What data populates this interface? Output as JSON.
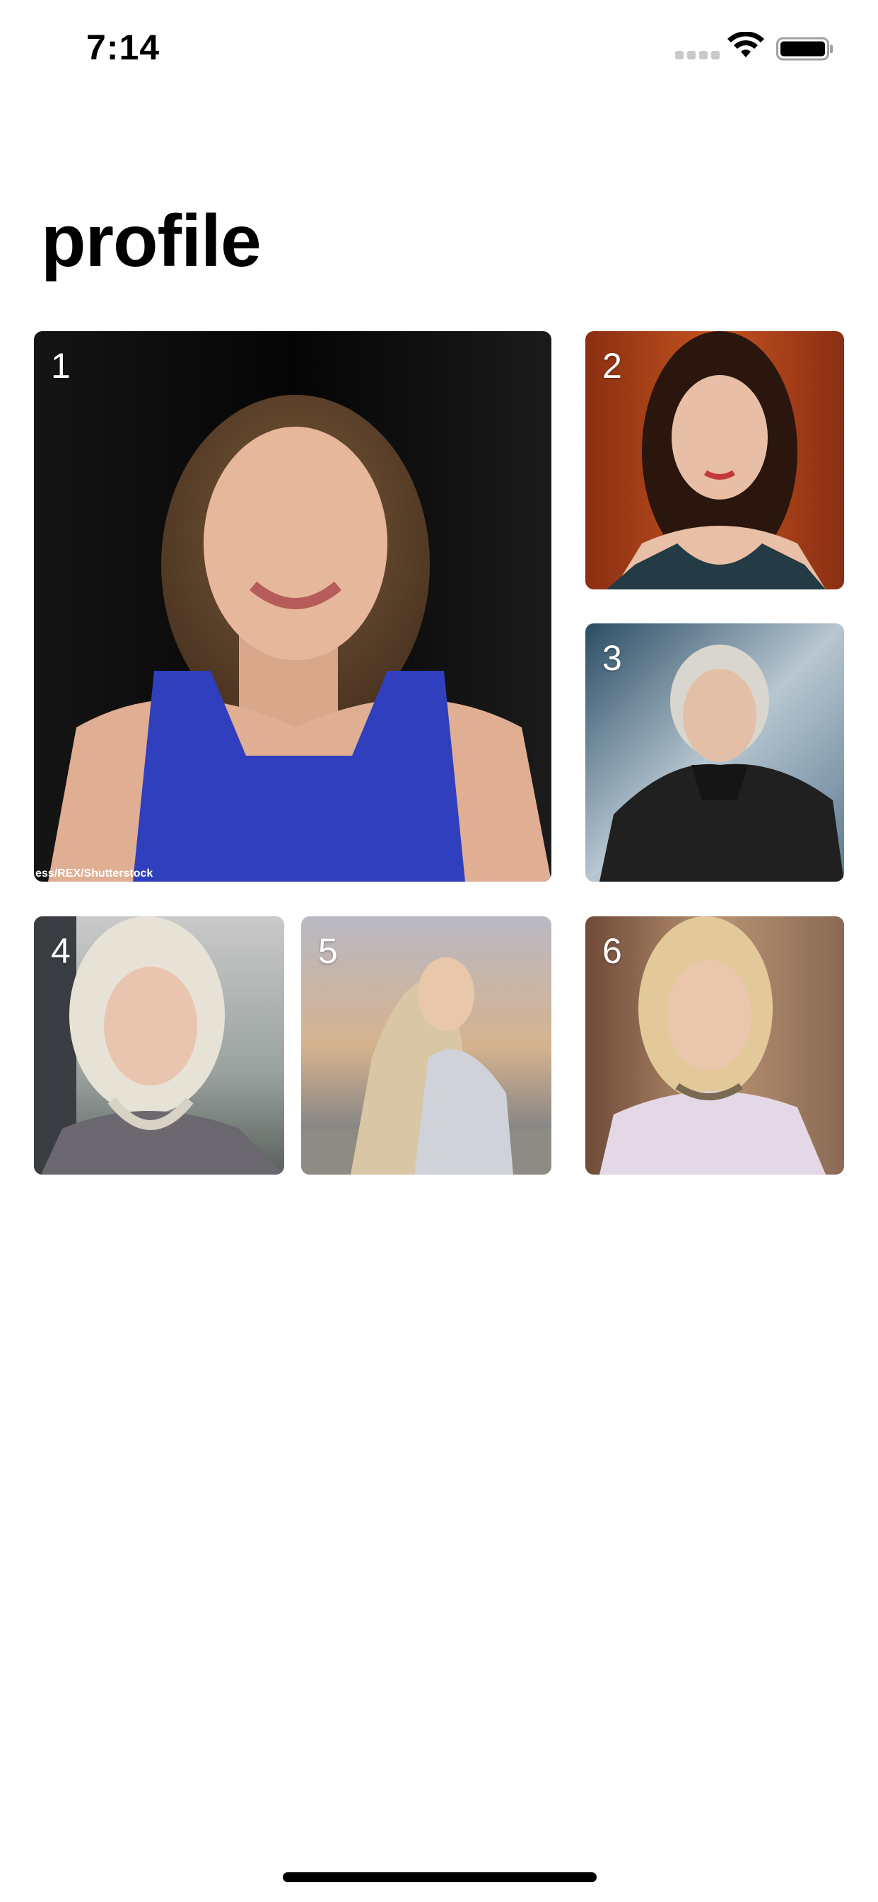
{
  "status_bar": {
    "time": "7:14",
    "icons": [
      "cellular-signal-icon",
      "wifi-icon",
      "battery-icon"
    ]
  },
  "page": {
    "title": "profile"
  },
  "photos": [
    {
      "number": "1",
      "description": "smiling woman in blue top",
      "credit": "ess/REX/Shutterstock"
    },
    {
      "number": "2",
      "description": "woman with dark wavy hair"
    },
    {
      "number": "3",
      "description": "platinum hair, dark coat"
    },
    {
      "number": "4",
      "description": "platinum braided hair, grey cloak"
    },
    {
      "number": "5",
      "description": "long braided hair, looking back"
    },
    {
      "number": "6",
      "description": "braided hair, white dress"
    }
  ],
  "colors": {
    "background": "#ffffff",
    "text": "#000000",
    "tile_number": "#ffffff"
  }
}
